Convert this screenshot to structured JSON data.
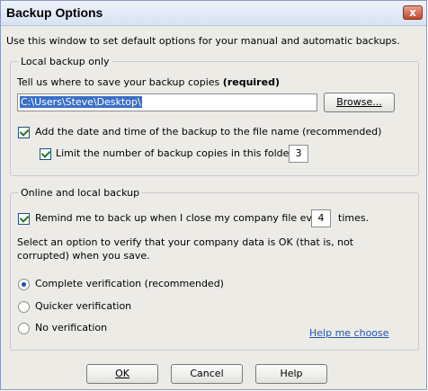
{
  "window": {
    "title": "Backup Options",
    "close_glyph": "x",
    "intro": "Use this window to set default options for your manual and automatic backups."
  },
  "local": {
    "group_title": "Local backup only",
    "path_prompt": "Tell us where to save your backup copies",
    "path_required": "(required)",
    "path_value": "C:\\Users\\Steve\\Desktop\\",
    "browse_label": "Browse...",
    "add_date_label": "Add the date and time of the backup to the file name (recommended)",
    "add_date_checked": true,
    "limit_label": "Limit the number of backup copies in this folder to",
    "limit_checked": true,
    "limit_value": "3"
  },
  "online": {
    "group_title": "Online and local backup",
    "remind_label": "Remind me to back up when I close my company file every",
    "remind_checked": true,
    "remind_value": "4",
    "times_label": "times.",
    "verify_text_1": "Select an option to verify that your company data is OK (that is, not",
    "verify_text_2": "corrupted) when you save.",
    "options": [
      {
        "label": "Complete verification (recommended)",
        "selected": true
      },
      {
        "label": "Quicker verification",
        "selected": false
      },
      {
        "label": "No verification",
        "selected": false
      }
    ],
    "help_link": "Help me choose"
  },
  "buttons": {
    "ok": "OK",
    "cancel": "Cancel",
    "help": "Help"
  }
}
